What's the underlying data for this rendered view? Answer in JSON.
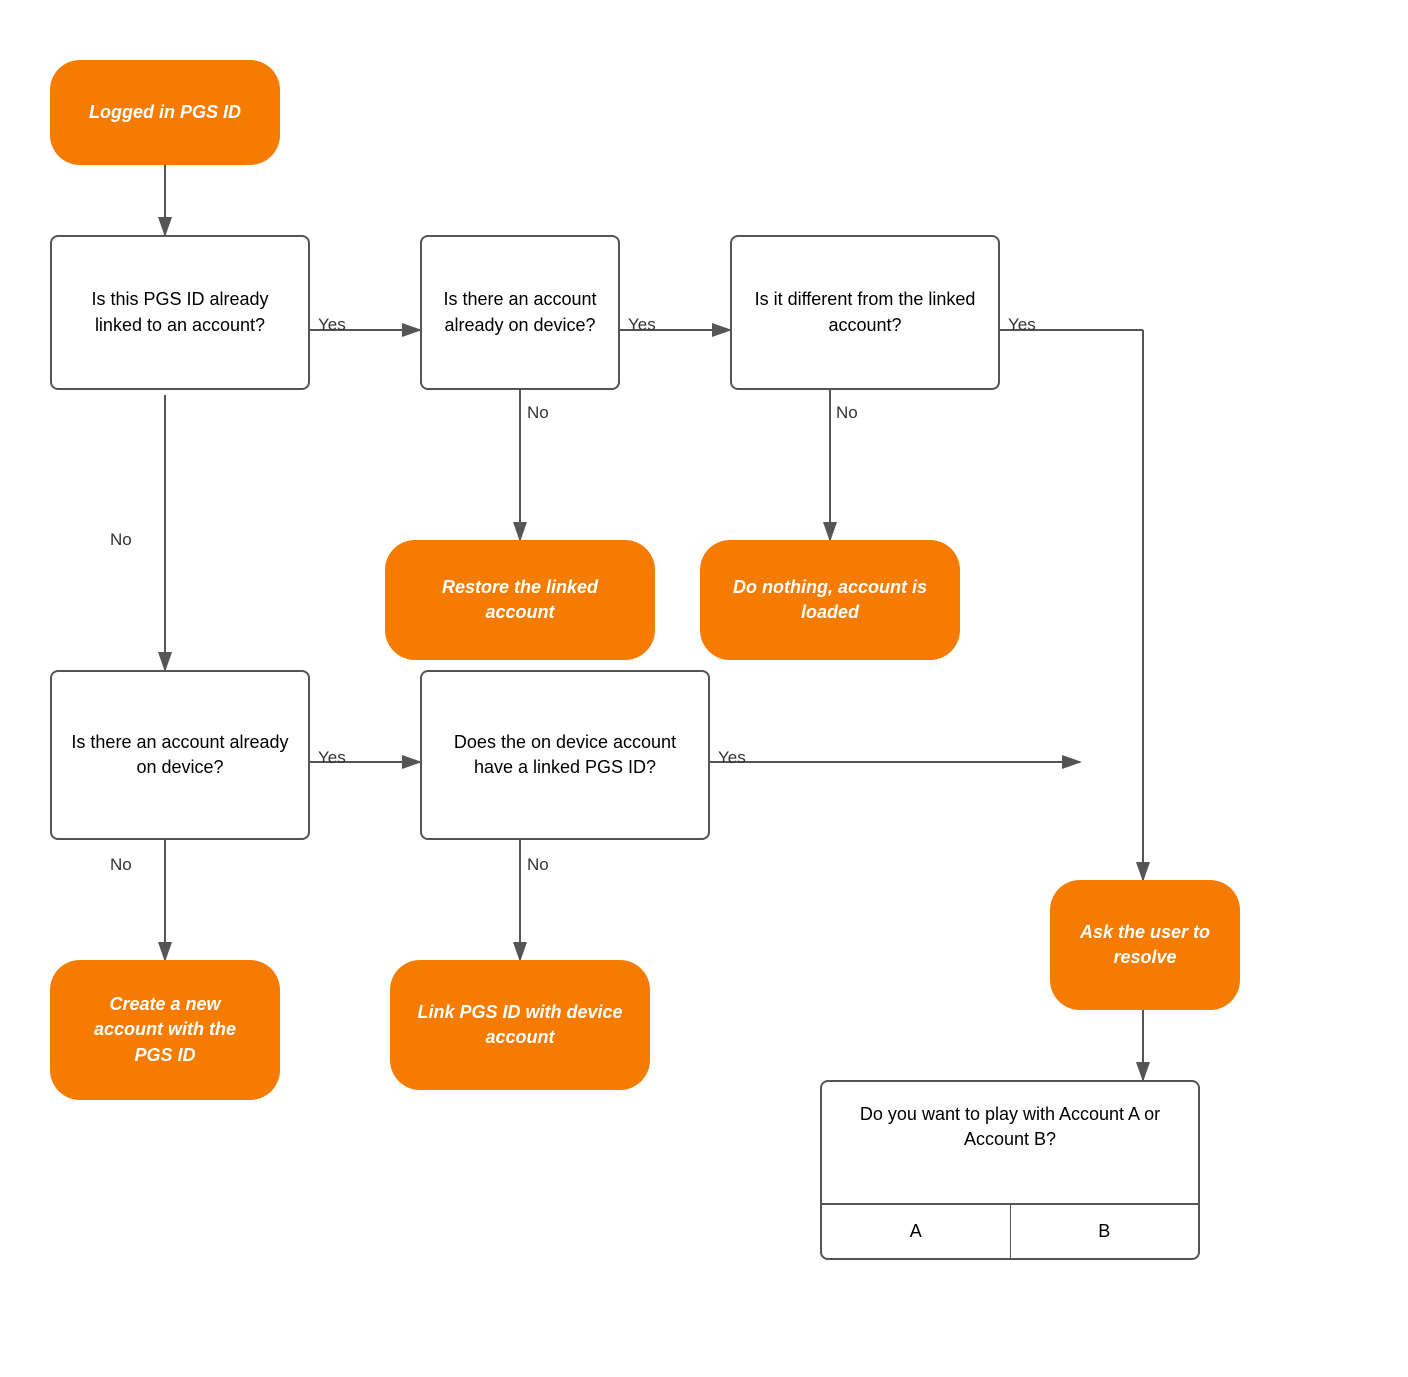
{
  "nodes": {
    "start": {
      "label": "Logged in PGS ID"
    },
    "q1": {
      "label": "Is this PGS ID already linked to an account?"
    },
    "q2": {
      "label": "Is there an account already on device?"
    },
    "q3": {
      "label": "Is it different from the linked account?"
    },
    "q4": {
      "label": "Is there an account already on device?"
    },
    "q5": {
      "label": "Does the on device account have a linked PGS ID?"
    },
    "a_restore": {
      "label": "Restore the linked account"
    },
    "a_donothing": {
      "label": "Do nothing, account is loaded"
    },
    "a_resolve": {
      "label": "Ask the user to resolve"
    },
    "a_create": {
      "label": "Create a new account with the PGS ID"
    },
    "a_link": {
      "label": "Link PGS ID with device account"
    }
  },
  "labels": {
    "yes": "Yes",
    "no": "No"
  },
  "dialog": {
    "body": "Do you want to play with Account A or Account B?",
    "btn_a": "A",
    "btn_b": "B"
  }
}
